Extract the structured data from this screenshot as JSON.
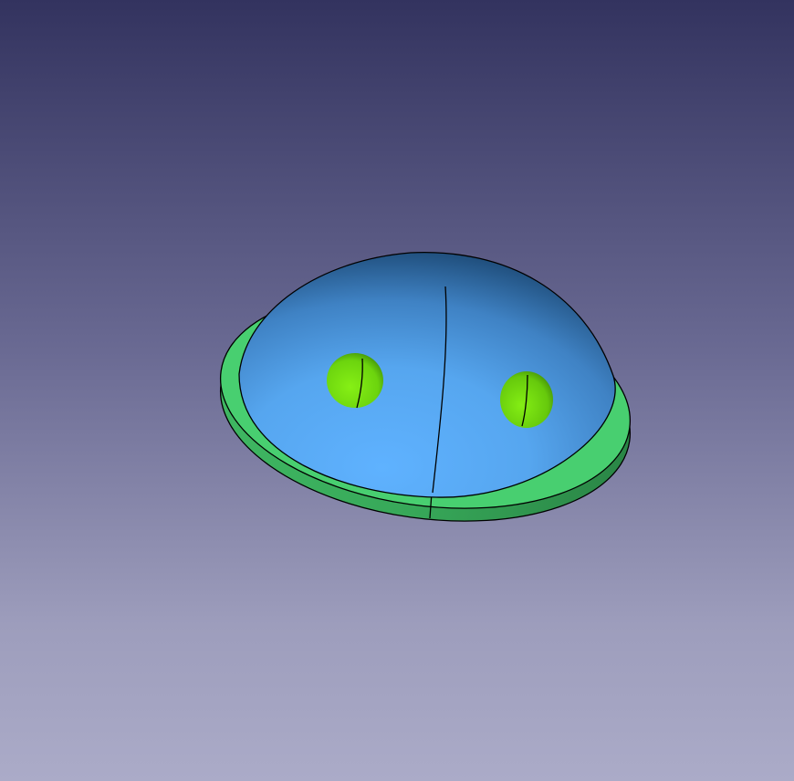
{
  "viewport": {
    "background_top": "#33335f",
    "background_bottom": "#ababc8"
  },
  "model": {
    "dome_color": "#5aaaf5",
    "dome_shadow_color": "#1f4f7c",
    "flange_color": "#46cc6d",
    "flange_side_color": "#35a45a",
    "sphere_color": "#76e010",
    "edge_color": "#000000"
  }
}
